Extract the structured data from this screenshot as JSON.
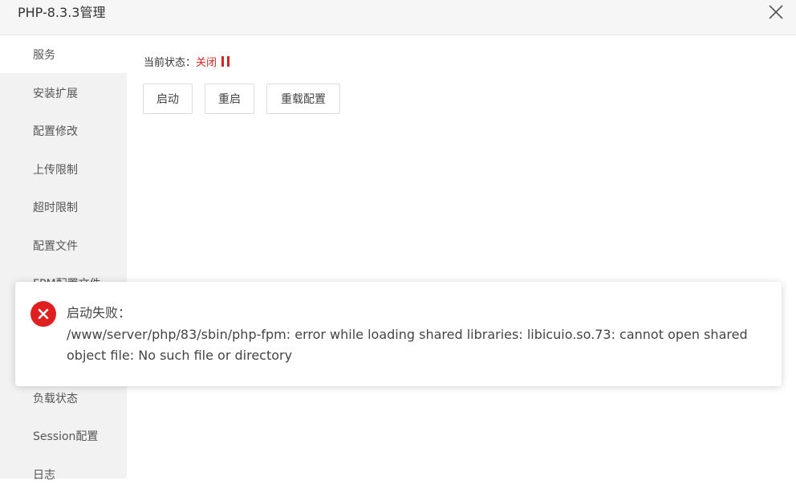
{
  "window": {
    "title": "PHP-8.3.3管理"
  },
  "sidebar": {
    "items": [
      {
        "label": "服务",
        "active": true
      },
      {
        "label": "安装扩展"
      },
      {
        "label": "配置修改"
      },
      {
        "label": "上传限制"
      },
      {
        "label": "超时限制"
      },
      {
        "label": "配置文件"
      },
      {
        "label": "FPM配置文件"
      },
      {
        "label": ""
      },
      {
        "label": "负载状态"
      },
      {
        "label": "Session配置"
      },
      {
        "label": "日志"
      }
    ]
  },
  "main": {
    "status_label": "当前状态：",
    "status_value": "关闭",
    "buttons": {
      "start": "启动",
      "restart": "重启",
      "reload": "重载配置"
    }
  },
  "toast": {
    "title": "启动失败：",
    "message": "/www/server/php/83/sbin/php-fpm: error while loading shared libraries: libicuio.so.73: cannot open shared object file: No such file or directory"
  },
  "colors": {
    "error": "#e02020",
    "sidebar_bg": "#f2f2f2"
  }
}
